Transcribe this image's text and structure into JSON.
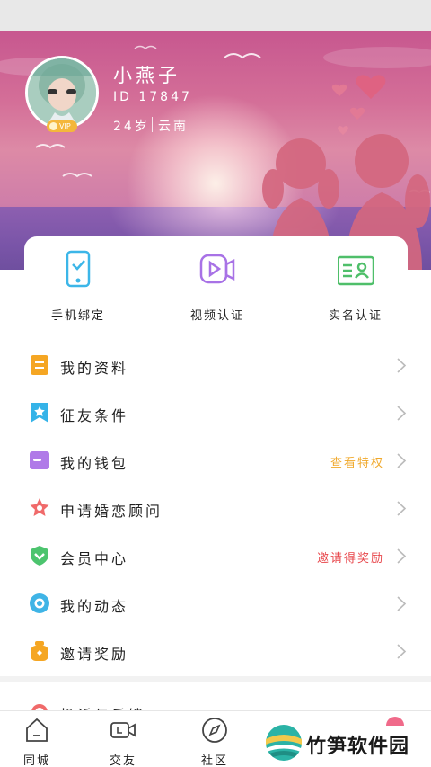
{
  "profile": {
    "name": "小燕子",
    "id_text": "ID 17847",
    "age": "24岁",
    "region": "云南",
    "vip_label": "VIP"
  },
  "verification": [
    {
      "label": "手机绑定",
      "icon": "phone-bind-icon",
      "color": "#3cb6e8"
    },
    {
      "label": "视频认证",
      "icon": "video-verify-icon",
      "color": "#a872e6"
    },
    {
      "label": "实名认证",
      "icon": "id-card-icon",
      "color": "#4fbf6a"
    }
  ],
  "menu": [
    {
      "label": "我的资料",
      "icon": "profile-doc-icon",
      "color": "#f5a623",
      "extra": ""
    },
    {
      "label": "征友条件",
      "icon": "bookmark-star-icon",
      "color": "#35b3e8",
      "extra": ""
    },
    {
      "label": "我的钱包",
      "icon": "wallet-icon",
      "color": "#b07ae8",
      "extra": "查看特权",
      "extra_color": "#f0a82a"
    },
    {
      "label": "申请婚恋顾问",
      "icon": "star-badge-icon",
      "color": "#f06a6a",
      "extra": ""
    },
    {
      "label": "会员中心",
      "icon": "shield-heart-icon",
      "color": "#4cc46e",
      "extra": "邀请得奖励",
      "extra_color": "#e8474c"
    },
    {
      "label": "我的动态",
      "icon": "bubble-icon",
      "color": "#3fb4e6",
      "extra": ""
    },
    {
      "label": "邀请奖励",
      "icon": "gift-jar-icon",
      "color": "#f5a623",
      "extra": ""
    },
    {
      "label": "投诉与反馈",
      "icon": "headset-icon",
      "color": "#f06a6a",
      "extra": ""
    }
  ],
  "tabs": [
    {
      "label": "同城",
      "icon": "home-icon"
    },
    {
      "label": "交友",
      "icon": "video-call-icon"
    },
    {
      "label": "社区",
      "icon": "compass-icon"
    }
  ],
  "watermark": {
    "text": "竹笋软件园"
  }
}
